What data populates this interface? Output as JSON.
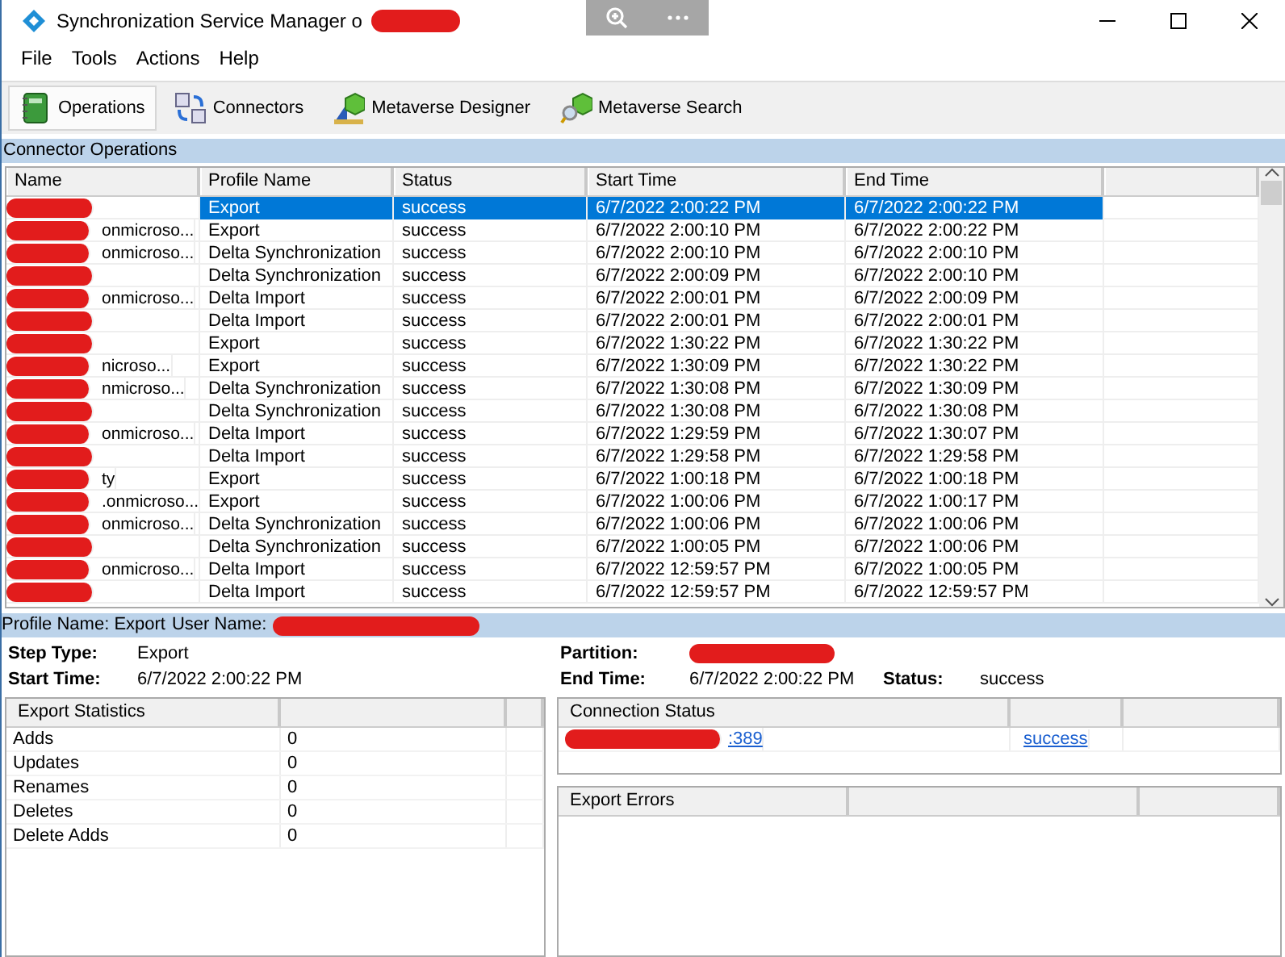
{
  "window": {
    "title": "Synchronization Service Manager o",
    "title_redacted": true
  },
  "menu": [
    "File",
    "Tools",
    "Actions",
    "Help"
  ],
  "toolbar": [
    {
      "label": "Operations",
      "kind": "operations",
      "selected": true
    },
    {
      "label": "Connectors",
      "kind": "connectors",
      "selected": false
    },
    {
      "label": "Metaverse Designer",
      "kind": "designer",
      "selected": false
    },
    {
      "label": "Metaverse Search",
      "kind": "search",
      "selected": false
    }
  ],
  "operations": {
    "title": "Connector Operations",
    "columns": [
      "Name",
      "Profile Name",
      "Status",
      "Start Time",
      "End Time"
    ],
    "rows": [
      {
        "redacted": true,
        "profile": "Export",
        "status": "success",
        "start": "6/7/2022 2:00:22 PM",
        "end": "6/7/2022 2:00:22 PM",
        "selected": true
      },
      {
        "redacted": true,
        "name": "onmicroso...",
        "profile": "Export",
        "status": "success",
        "start": "6/7/2022 2:00:10 PM",
        "end": "6/7/2022 2:00:22 PM",
        "selected": false
      },
      {
        "redacted": true,
        "name": "onmicroso...",
        "profile": "Delta Synchronization",
        "status": "success",
        "start": "6/7/2022 2:00:10 PM",
        "end": "6/7/2022 2:00:10 PM",
        "selected": false
      },
      {
        "redacted": true,
        "profile": "Delta Synchronization",
        "status": "success",
        "start": "6/7/2022 2:00:09 PM",
        "end": "6/7/2022 2:00:10 PM",
        "selected": false
      },
      {
        "redacted": true,
        "name": "onmicroso...",
        "profile": "Delta Import",
        "status": "success",
        "start": "6/7/2022 2:00:01 PM",
        "end": "6/7/2022 2:00:09 PM",
        "selected": false
      },
      {
        "redacted": true,
        "profile": "Delta Import",
        "status": "success",
        "start": "6/7/2022 2:00:01 PM",
        "end": "6/7/2022 2:00:01 PM",
        "selected": false
      },
      {
        "redacted": true,
        "profile": "Export",
        "status": "success",
        "start": "6/7/2022 1:30:22 PM",
        "end": "6/7/2022 1:30:22 PM",
        "selected": false
      },
      {
        "redacted": true,
        "name": "nicroso...",
        "profile": "Export",
        "status": "success",
        "start": "6/7/2022 1:30:09 PM",
        "end": "6/7/2022 1:30:22 PM",
        "selected": false
      },
      {
        "redacted": true,
        "name": "nmicroso...",
        "profile": "Delta Synchronization",
        "status": "success",
        "start": "6/7/2022 1:30:08 PM",
        "end": "6/7/2022 1:30:09 PM",
        "selected": false
      },
      {
        "redacted": true,
        "profile": "Delta Synchronization",
        "status": "success",
        "start": "6/7/2022 1:30:08 PM",
        "end": "6/7/2022 1:30:08 PM",
        "selected": false
      },
      {
        "redacted": true,
        "name": "onmicroso...",
        "profile": "Delta Import",
        "status": "success",
        "start": "6/7/2022 1:29:59 PM",
        "end": "6/7/2022 1:30:07 PM",
        "selected": false
      },
      {
        "redacted": true,
        "profile": "Delta Import",
        "status": "success",
        "start": "6/7/2022 1:29:58 PM",
        "end": "6/7/2022 1:29:58 PM",
        "selected": false
      },
      {
        "redacted": true,
        "name": "ty",
        "profile": "Export",
        "status": "success",
        "start": "6/7/2022 1:00:18 PM",
        "end": "6/7/2022 1:00:18 PM",
        "selected": false
      },
      {
        "redacted": true,
        "name": ".onmicroso...",
        "profile": "Export",
        "status": "success",
        "start": "6/7/2022 1:00:06 PM",
        "end": "6/7/2022 1:00:17 PM",
        "selected": false
      },
      {
        "redacted": true,
        "name": "onmicroso...",
        "profile": "Delta Synchronization",
        "status": "success",
        "start": "6/7/2022 1:00:06 PM",
        "end": "6/7/2022 1:00:06 PM",
        "selected": false
      },
      {
        "redacted": true,
        "profile": "Delta Synchronization",
        "status": "success",
        "start": "6/7/2022 1:00:05 PM",
        "end": "6/7/2022 1:00:06 PM",
        "selected": false
      },
      {
        "redacted": true,
        "name": "onmicroso...",
        "profile": "Delta Import",
        "status": "success",
        "start": "6/7/2022 12:59:57 PM",
        "end": "6/7/2022 1:00:05 PM",
        "selected": false
      },
      {
        "redacted": true,
        "profile": "Delta Import",
        "status": "success",
        "start": "6/7/2022 12:59:57 PM",
        "end": "6/7/2022 12:59:57 PM",
        "selected": false
      }
    ]
  },
  "details": {
    "profile_name": "Profile Name: Export",
    "user_name_label": "User Name:",
    "user_name_redacted": true,
    "step_type_label": "Step Type:",
    "step_type": "Export",
    "start_time_label": "Start Time:",
    "start_time": "6/7/2022 2:00:22 PM",
    "partition_label": "Partition:",
    "partition_redacted": true,
    "end_time_label": "End Time:",
    "end_time": "6/7/2022 2:00:22 PM",
    "status_label": "Status:",
    "status": "success"
  },
  "export_statistics": {
    "title": "Export Statistics",
    "rows": [
      {
        "label": "Adds",
        "value": "0"
      },
      {
        "label": "Updates",
        "value": "0"
      },
      {
        "label": "Renames",
        "value": "0"
      },
      {
        "label": "Deletes",
        "value": "0"
      },
      {
        "label": "Delete Adds",
        "value": "0"
      }
    ]
  },
  "connection_status": {
    "title": "Connection Status",
    "rows": [
      {
        "server": ":389",
        "server_redacted": true,
        "status": "success"
      }
    ]
  },
  "export_errors": {
    "title": "Export Errors"
  }
}
